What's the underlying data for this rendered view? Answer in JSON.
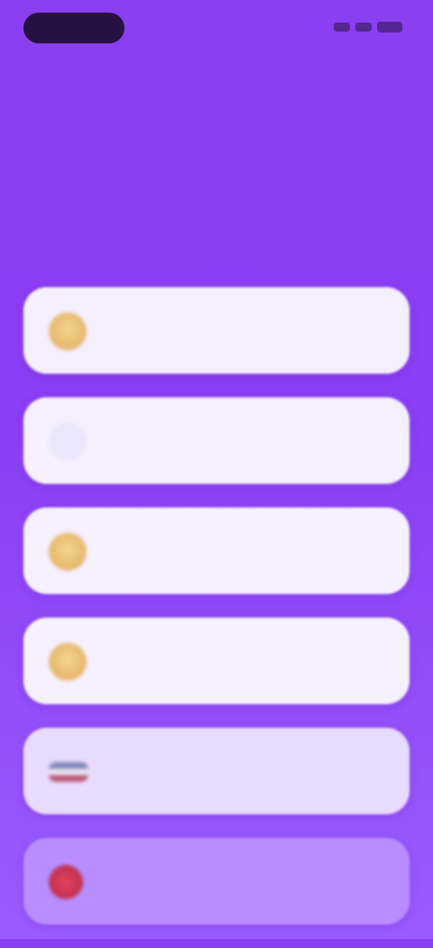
{
  "status_bar": {
    "time": ""
  },
  "heading": {
    "title": "",
    "subtitle": ""
  },
  "options": [
    {
      "label": "",
      "icon": "gold-circle-icon"
    },
    {
      "label": "",
      "icon": "blank-icon"
    },
    {
      "label": "",
      "icon": "gold-circle-icon"
    },
    {
      "label": "",
      "icon": "gold-circle-icon"
    },
    {
      "label": "",
      "icon": "flag-icon"
    },
    {
      "label": "",
      "icon": "red-circle-icon"
    }
  ],
  "colors": {
    "background_top": "#8a3ff0",
    "background_bottom": "#9b5bff",
    "card": "#faf8ff",
    "accent_gold": "#e5b86e",
    "accent_pink": "#ff78a0"
  }
}
